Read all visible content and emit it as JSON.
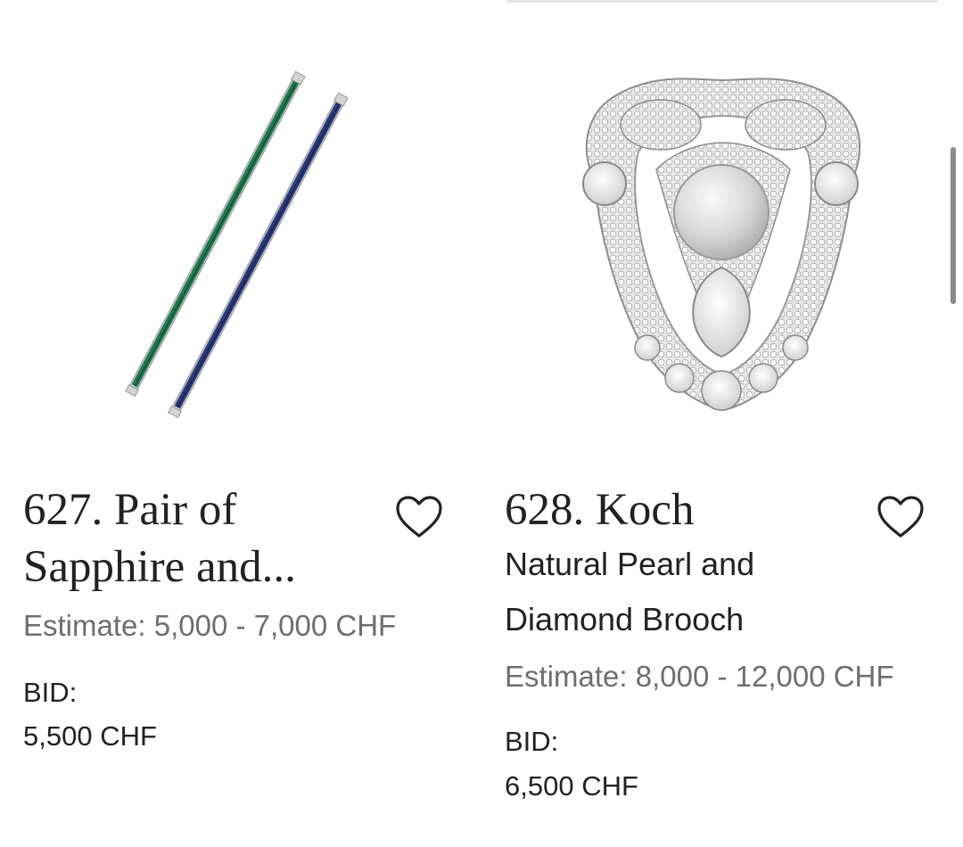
{
  "lots": [
    {
      "title": "627. Pair of Sapphire and...",
      "subtitle": "",
      "estimate": "Estimate: 5,000 - 7,000 CHF",
      "bid_label": "BID:",
      "bid_value": "5,500 CHF",
      "favorite_icon": "heart-outline-icon",
      "image": "emerald-and-sapphire-bar-brooches"
    },
    {
      "title": "628. Koch",
      "subtitle": "Natural Pearl and Diamond Brooch",
      "estimate": "Estimate: 8,000 - 12,000 CHF",
      "bid_label": "BID:",
      "bid_value": "6,500 CHF",
      "favorite_icon": "heart-outline-icon",
      "image": "pearl-and-diamond-brooch"
    }
  ],
  "colors": {
    "text": "#222222",
    "muted": "#6e6e6e",
    "emerald": "#1f7a4f",
    "sapphire": "#2c3a7a",
    "pearl": "#d9d9d9"
  }
}
